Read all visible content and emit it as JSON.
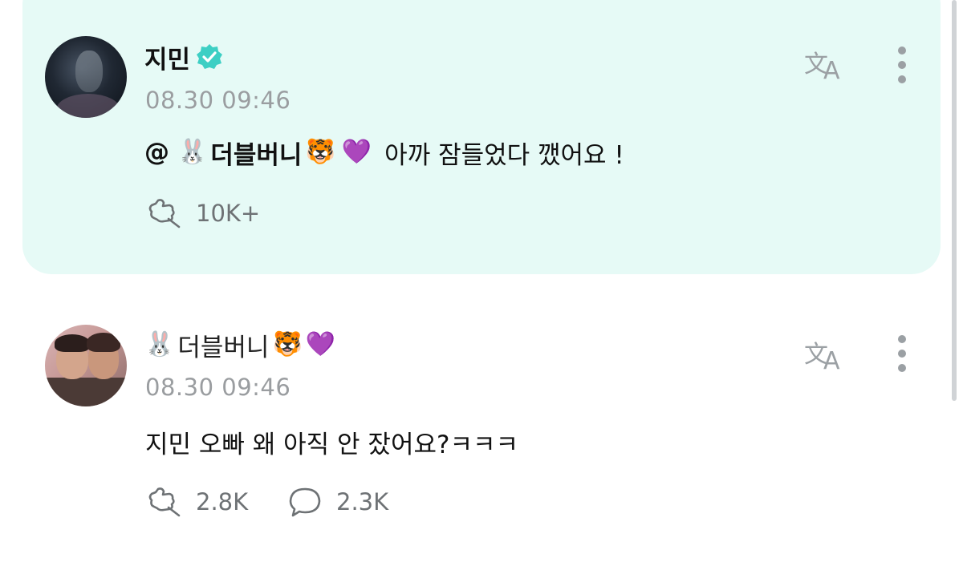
{
  "posts": [
    {
      "username": "지민",
      "verified": true,
      "timestamp": "08.30 09:46",
      "mention": {
        "at": "@",
        "emoji_before": "🐰",
        "name": "더블버니",
        "emoji_tiger": "🐯",
        "emoji_heart": "💜"
      },
      "text": "아까 잠들었다 깼어요 !",
      "likes": "10K+",
      "highlight_color": "#e6faf6"
    },
    {
      "username_emoji_before": "🐰",
      "username": "더블버니",
      "username_emoji_tiger": "🐯",
      "username_emoji_heart": "💜",
      "timestamp": "08.30 09:46",
      "text": "지민 오빠 왜 아직 안 잤어요?ㅋㅋㅋ",
      "likes": "2.8K",
      "comments": "2.3K"
    }
  ],
  "icons": {
    "translate": "translate-icon",
    "more": "more-vertical-icon",
    "like": "like-hand-icon",
    "comment": "comment-bubble-icon",
    "verified": "verified-badge-icon"
  },
  "colors": {
    "verified": "#3dcfc4",
    "meta_text": "#9a9da0",
    "action_text": "#6e7275"
  }
}
